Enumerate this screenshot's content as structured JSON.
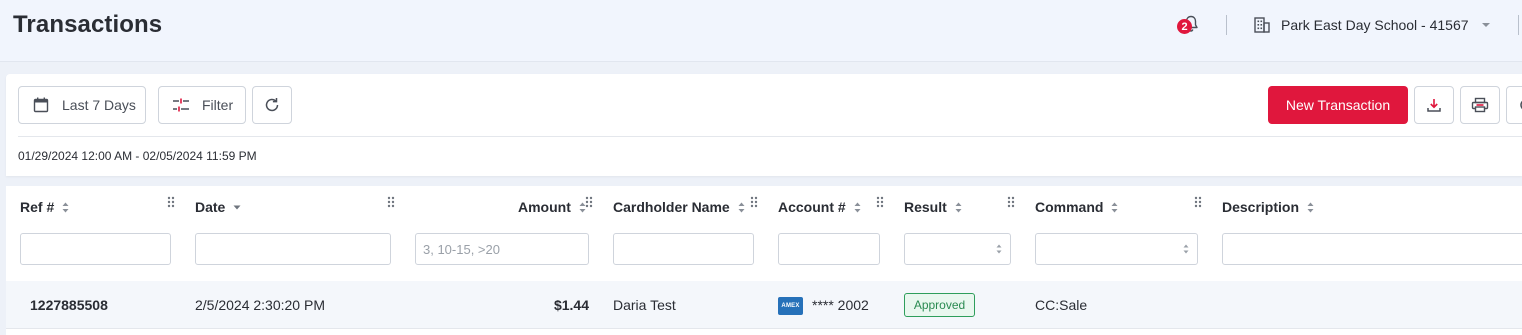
{
  "header": {
    "title": "Transactions",
    "notification_count": "2",
    "organization": "Park East Day School - 41567"
  },
  "toolbar": {
    "date_filter_label": "Last 7 Days",
    "filter_label": "Filter",
    "new_transaction_label": "New Transaction",
    "date_range": "01/29/2024 12:00 AM - 02/05/2024 11:59 PM"
  },
  "grid": {
    "columns": [
      {
        "label": "Ref #"
      },
      {
        "label": "Date"
      },
      {
        "label": "Amount"
      },
      {
        "label": "Cardholder Name"
      },
      {
        "label": "Account #"
      },
      {
        "label": "Result"
      },
      {
        "label": "Command"
      },
      {
        "label": "Description"
      }
    ],
    "filters": {
      "amount_placeholder": "3, 10-15, >20"
    },
    "rows": [
      {
        "ref": "1227885508",
        "date": "2/5/2024  2:30:20 PM",
        "amount": "$1.44",
        "cardholder": "Daria Test",
        "card_brand": "AMEX",
        "account": "**** 2002",
        "result": "Approved",
        "command": "CC:Sale",
        "description": ""
      }
    ]
  },
  "colors": {
    "accent": "#e0173d",
    "approved": "#2e9e5b",
    "amex": "#2671b9"
  },
  "icons": {
    "notifications": "bell-icon",
    "organization": "building-icon",
    "calendar": "calendar-icon",
    "filter": "sliders-icon",
    "refresh": "refresh-icon",
    "download": "download-icon",
    "print": "printer-icon",
    "settings": "gear-icon"
  }
}
